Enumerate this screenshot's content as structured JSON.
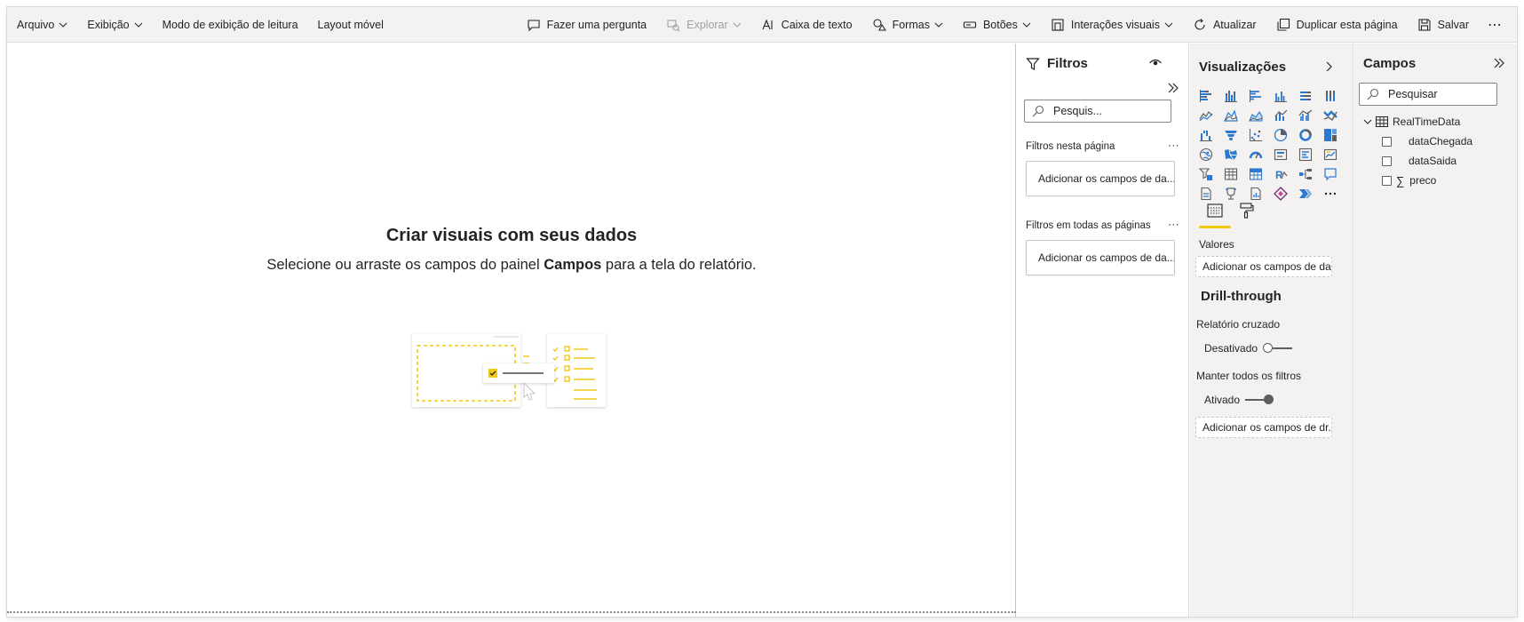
{
  "toolbar": {
    "left": [
      {
        "label": "Arquivo",
        "has_chevron": true
      },
      {
        "label": "Exibição",
        "has_chevron": true
      },
      {
        "label": "Modo de exibição de leitura",
        "has_chevron": false
      },
      {
        "label": "Layout móvel",
        "has_chevron": false
      }
    ],
    "right": [
      {
        "label": "Fazer uma pergunta",
        "icon": "chat-icon"
      },
      {
        "label": "Explorar",
        "icon": "explore-icon",
        "has_chevron": true,
        "disabled": true
      },
      {
        "label": "Caixa de texto",
        "icon": "text-box-icon"
      },
      {
        "label": "Formas",
        "icon": "shapes-icon",
        "has_chevron": true
      },
      {
        "label": "Botões",
        "icon": "buttons-icon",
        "has_chevron": true
      },
      {
        "label": "Interações visuais",
        "icon": "visual-interactions-icon",
        "has_chevron": true
      },
      {
        "label": "Atualizar",
        "icon": "refresh-icon"
      },
      {
        "label": "Duplicar esta página",
        "icon": "duplicate-icon"
      },
      {
        "label": "Salvar",
        "icon": "save-icon"
      }
    ],
    "more": "⋯"
  },
  "canvas": {
    "empty_title": "Criar visuais com seus dados",
    "empty_sub_before": "Selecione ou arraste os campos do painel ",
    "empty_sub_bold": "Campos",
    "empty_sub_after": " para a tela do relatório."
  },
  "filters": {
    "title": "Filtros",
    "search_placeholder": "Pesquis...",
    "page_section": "Filtros nesta página",
    "page_drop": "Adicionar os campos de da...",
    "all_section": "Filtros em todas as páginas",
    "all_drop": "Adicionar os campos de da...",
    "more": "⋯"
  },
  "visualizations": {
    "title": "Visualizações",
    "icons": [
      "stacked-bar-chart-icon",
      "stacked-column-chart-icon",
      "clustered-bar-chart-icon",
      "clustered-column-chart-icon",
      "100-stacked-bar-chart-icon",
      "100-stacked-column-chart-icon",
      "line-chart-icon",
      "area-chart-icon",
      "stacked-area-chart-icon",
      "line-and-stacked-column-chart-icon",
      "line-and-clustered-column-chart-icon",
      "ribbon-chart-icon",
      "waterfall-chart-icon",
      "funnel-chart-icon",
      "scatter-chart-icon",
      "pie-chart-icon",
      "donut-chart-icon",
      "treemap-icon",
      "map-icon",
      "filled-map-icon",
      "gauge-icon",
      "card-icon",
      "multi-row-card-icon",
      "kpi-icon",
      "slicer-icon",
      "table-icon",
      "matrix-icon",
      "r-script-visual-icon",
      "decomposition-tree-icon",
      "qa-visual-icon",
      "paginated-report-icon",
      "key-influencers-icon",
      "python-visual-icon",
      "power-apps-icon",
      "power-automate-icon",
      "more-visuals-icon"
    ],
    "values_label": "Valores",
    "values_drop": "Adicionar os campos de da...",
    "drill_title": "Drill-through",
    "cross_report_label": "Relatório cruzado",
    "cross_report_state": "Desativado",
    "keep_filters_label": "Manter todos os filtros",
    "keep_filters_state": "Ativado",
    "drill_drop": "Adicionar os campos de dr..."
  },
  "fields": {
    "title": "Campos",
    "search_placeholder": "Pesquisar",
    "table_name": "RealTimeData",
    "columns": [
      {
        "name": "dataChegada",
        "sigma": false
      },
      {
        "name": "dataSaida",
        "sigma": false
      },
      {
        "name": "preco",
        "sigma": true
      }
    ]
  },
  "colors": {
    "accent_yellow": "#f2c811",
    "viz_blue": "#2b78d0",
    "text": "#252423",
    "pane_bg": "#f3f2f1"
  }
}
